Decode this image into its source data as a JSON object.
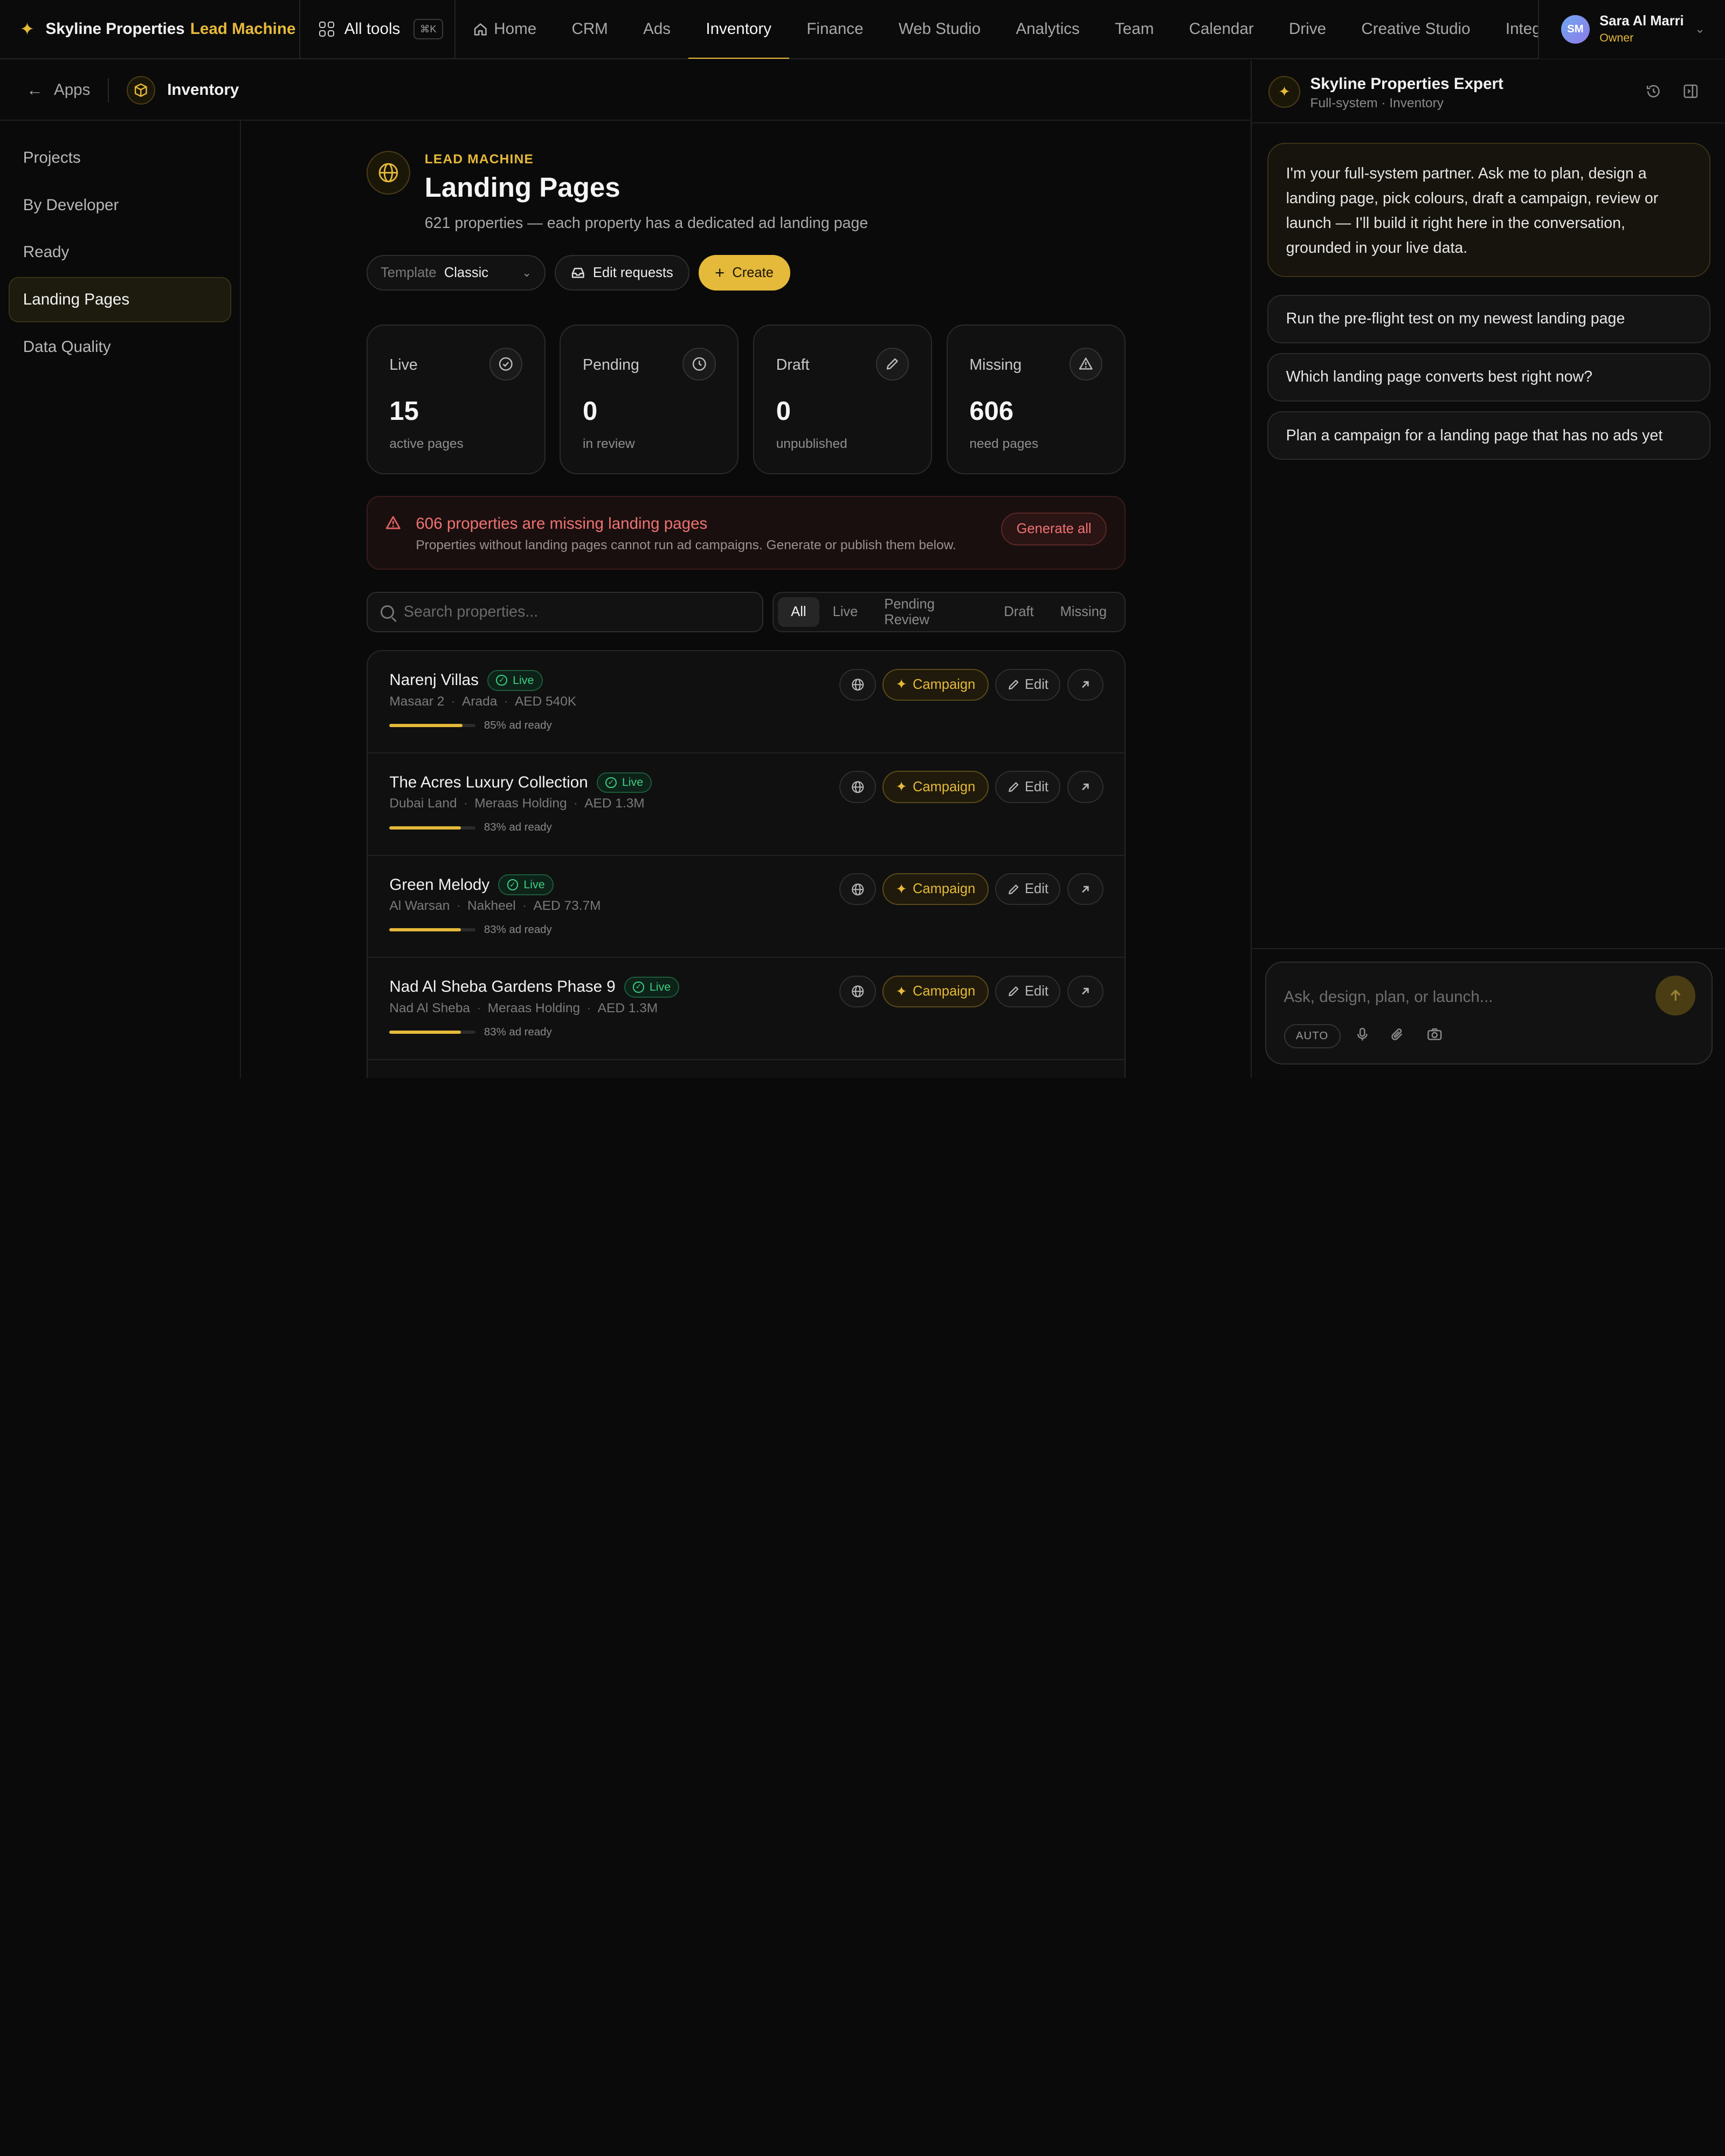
{
  "colors": {
    "accent": "#e5b93a",
    "live": "#3ccf83",
    "danger": "#f07272",
    "bg": "#0a0a0a"
  },
  "topbar": {
    "brand_name": "Skyline Properties",
    "brand_accent": "Lead Machine",
    "all_tools": "All tools",
    "shortcut": "⌘K",
    "nav": [
      "Home",
      "CRM",
      "Ads",
      "Inventory",
      "Finance",
      "Web Studio",
      "Analytics",
      "Team",
      "Calendar",
      "Drive",
      "Creative Studio",
      "Integ"
    ],
    "active_nav": "Inventory"
  },
  "user": {
    "initials": "SM",
    "name": "Sara Al Marri",
    "role": "Owner"
  },
  "breadcrumb": {
    "back": "Apps",
    "current": "Inventory"
  },
  "sidebar": {
    "items": [
      "Projects",
      "By Developer",
      "Ready",
      "Landing Pages",
      "Data Quality"
    ],
    "active": "Landing Pages"
  },
  "main": {
    "eyebrow": "LEAD MACHINE",
    "title": "Landing Pages",
    "subtitle": "621 properties — each property has a dedicated ad landing page",
    "template_label": "Template",
    "template_value": "Classic",
    "edit_requests": "Edit requests",
    "create": "Create"
  },
  "stats": [
    {
      "title": "Live",
      "value": "15",
      "desc": "active pages",
      "icon": "check-circle-icon"
    },
    {
      "title": "Pending",
      "value": "0",
      "desc": "in review",
      "icon": "clock-icon"
    },
    {
      "title": "Draft",
      "value": "0",
      "desc": "unpublished",
      "icon": "pencil-icon"
    },
    {
      "title": "Missing",
      "value": "606",
      "desc": "need pages",
      "icon": "warning-icon"
    }
  ],
  "alert": {
    "title": "606 properties are missing landing pages",
    "desc": "Properties without landing pages cannot run ad campaigns. Generate or publish them below.",
    "action": "Generate all"
  },
  "search": {
    "placeholder": "Search properties..."
  },
  "filters": {
    "items": [
      "All",
      "Live",
      "Pending Review",
      "Draft",
      "Missing"
    ],
    "active": "All"
  },
  "row_actions": {
    "campaign": "Campaign",
    "edit": "Edit"
  },
  "properties": [
    {
      "name": "Narenj Villas",
      "status": "Live",
      "area": "Masaar 2",
      "developer": "Arada",
      "price": "AED 540K",
      "ready_pct": 85,
      "ready_text": "85% ad ready"
    },
    {
      "name": "The Acres Luxury Collection",
      "status": "Live",
      "area": "Dubai Land",
      "developer": "Meraas Holding",
      "price": "AED 1.3M",
      "ready_pct": 83,
      "ready_text": "83% ad ready"
    },
    {
      "name": "Green Melody",
      "status": "Live",
      "area": "Al Warsan",
      "developer": "Nakheel",
      "price": "AED 73.7M",
      "ready_pct": 83,
      "ready_text": "83% ad ready"
    },
    {
      "name": "Nad Al Sheba Gardens Phase 9",
      "status": "Live",
      "area": "Nad Al Sheba",
      "developer": "Meraas Holding",
      "price": "AED 1.3M",
      "ready_pct": 83,
      "ready_text": "83% ad ready"
    }
  ],
  "panel": {
    "title": "Skyline Properties Expert",
    "subtitle": "Full-system · Inventory",
    "intro": "I'm your full-system partner. Ask me to plan, design a landing page, pick colours, draft a campaign, review or launch — I'll build it right here in the conversation, grounded in your live data.",
    "suggestions": [
      "Run the pre-flight test on my newest landing page",
      "Which landing page converts best right now?",
      "Plan a campaign for a landing page that has no ads yet"
    ],
    "composer_placeholder": "Ask, design, plan, or launch...",
    "mode": "AUTO"
  }
}
